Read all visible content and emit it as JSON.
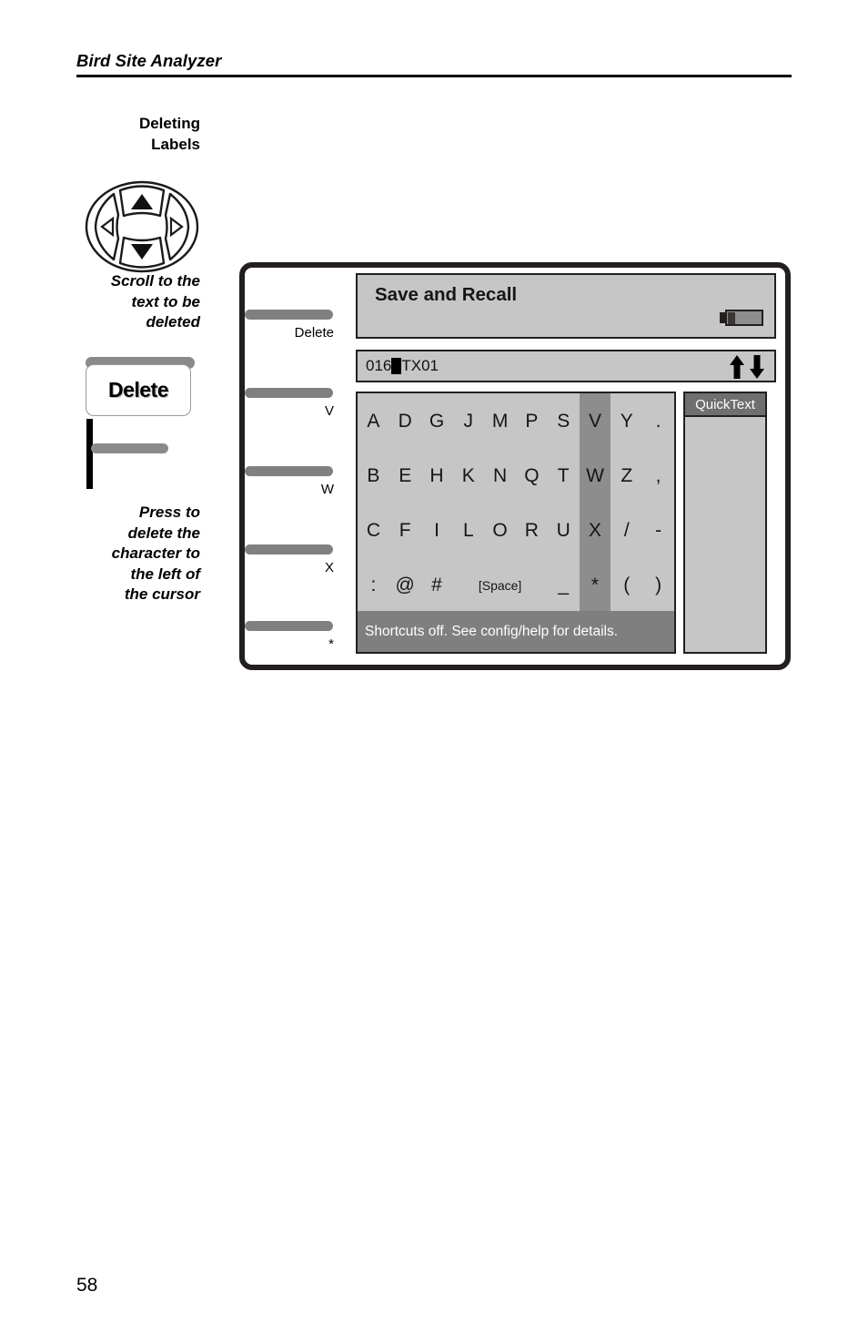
{
  "page": {
    "running_header": "Bird Site Analyzer",
    "number": "58"
  },
  "section": {
    "heading_line1": "Deleting",
    "heading_line2": "Labels"
  },
  "captions": {
    "scroll": {
      "line1": "Scroll to the",
      "line2": "text to be",
      "line3": "deleted"
    },
    "press": {
      "line1": "Press to",
      "line2": "delete the",
      "line3": "character to",
      "line4": "the left of",
      "line5": "the cursor"
    }
  },
  "key_art": {
    "delete_label": "Delete"
  },
  "dpad": {
    "up_icon": "arrow-up-icon",
    "down_icon": "arrow-down-icon",
    "left_icon": "arrow-left-icon",
    "right_icon": "arrow-right-icon"
  },
  "device": {
    "softkeys": [
      {
        "label": "Delete"
      },
      {
        "label": "V"
      },
      {
        "label": "W"
      },
      {
        "label": "X"
      },
      {
        "label": "*"
      }
    ],
    "screen": {
      "title": "Save and Recall",
      "battery_icon": "battery-icon",
      "text_field": {
        "value_before_cursor": "016",
        "value_after_cursor": "TX01",
        "cursor": "block-cursor",
        "scroll_up_icon": "arrow-up-icon",
        "scroll_down_icon": "arrow-down-icon"
      },
      "keyboard": {
        "selected_column_index": 7,
        "rows": [
          [
            "A",
            "D",
            "G",
            "J",
            "M",
            "P",
            "S",
            "V",
            "Y",
            "."
          ],
          [
            "B",
            "E",
            "H",
            "K",
            "N",
            "Q",
            "T",
            "W",
            "Z",
            ","
          ],
          [
            "C",
            "F",
            "I",
            "L",
            "O",
            "R",
            "U",
            "X",
            "/",
            "-"
          ],
          [
            ":",
            "@",
            "#",
            "[Space]",
            "_",
            "*",
            "(",
            ")"
          ]
        ]
      },
      "status_text": "Shortcuts off. See config/help for details.",
      "quicktext": {
        "header": "QuickText",
        "items": []
      }
    }
  },
  "colors": {
    "screen_panel": "#c6c6c6",
    "screen_border": "#231f1e",
    "selected_column": "#8d8d8d",
    "status_bar": "#7f7f7f",
    "quicktext_header": "#6f6f6f",
    "softkey_bar": "#808080"
  }
}
